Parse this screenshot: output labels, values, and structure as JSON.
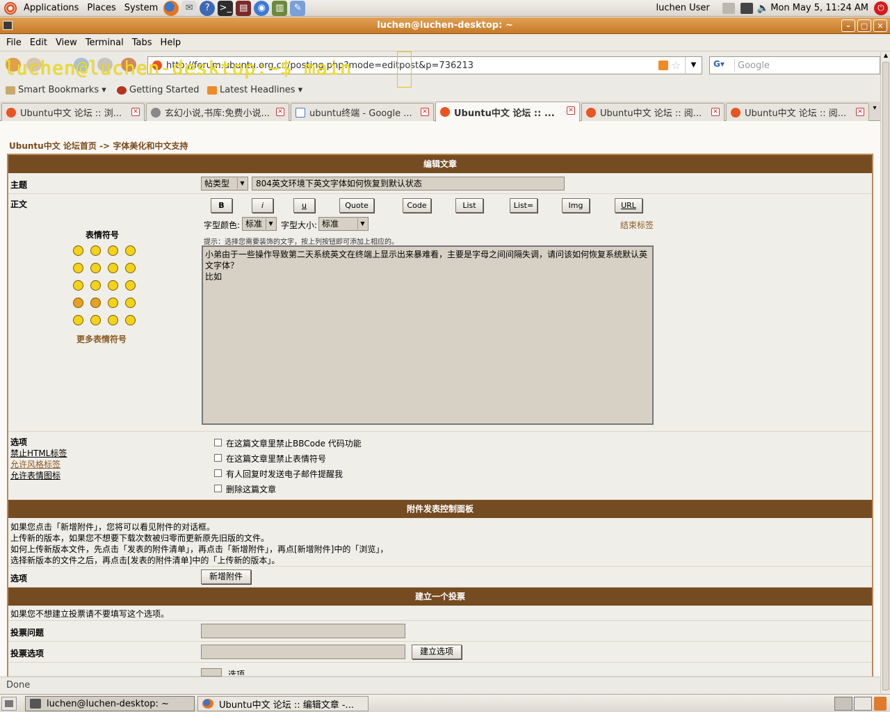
{
  "top_panel": {
    "menus": [
      "Applications",
      "Places",
      "System"
    ],
    "user": "luchen User",
    "clock": "Mon May  5, 11:24 AM"
  },
  "window": {
    "title": "luchen@luchen-desktop: ~"
  },
  "terminal_menu": [
    "File",
    "Edit",
    "View",
    "Terminal",
    "Tabs",
    "Help"
  ],
  "terminal": {
    "prompt": "luchen@luchen-desktop:~$ main"
  },
  "browser": {
    "url": "http://forum.ubuntu.org.cn/posting.php?mode=editpost&p=736213",
    "search_placeholder": "Google",
    "bookmarks": [
      "Smart Bookmarks",
      "Getting Started",
      "Latest Headlines"
    ],
    "tabs": [
      "Ubuntu中文 论坛 :: 浏...",
      "玄幻小说,书库:免费小说...",
      "ubuntu终端 - Google ...",
      "Ubuntu中文 论坛 :: ...",
      "Ubuntu中文 论坛 :: 阅...",
      "Ubuntu中文 论坛 :: 阅..."
    ],
    "status": "Done"
  },
  "page": {
    "breadcrumb_home": "Ubuntu中文 论坛首页",
    "breadcrumb_sep": "->",
    "breadcrumb_forum": "字体美化和中文支持",
    "edit_header": "编辑文章",
    "subject_label": "主题",
    "post_type": "帖类型",
    "subject_value": "804英文环境下英文字体如何恢复到默认状态",
    "body_label": "正文",
    "smilies_title": "表情符号",
    "more_smilies": "更多表情符号",
    "format_buttons": [
      "B",
      "i",
      "u",
      "Quote",
      "Code",
      "List",
      "List=",
      "Img",
      "URL"
    ],
    "font_color_label": "字型颜色:",
    "font_color_value": "标准",
    "font_size_label": "字型大小:",
    "font_size_value": "标准",
    "close_tags": "结束标签",
    "hint": "提示：选择您需要装饰的文字，按上列按钮即可添加上相应的。",
    "body_text": "小弟由于一些操作导致第二天系统英文在终端上显示出来暴难看，主要是字母之间间隔失调，请问该如何恢复系统默认英文字体？\n比如",
    "options_label": "选项",
    "options_notes": [
      "禁止HTML标签",
      "允许风格标签",
      "允许表情图标"
    ],
    "options": [
      "在这篇文章里禁止BBCode 代码功能",
      "在这篇文章里禁止表情符号",
      "有人回复时发送电子邮件提醒我",
      "删除这篇文章"
    ],
    "attach_header": "附件发表控制面板",
    "attach_lines": [
      "如果您点击「新增附件」，您将可以看见附件的对话框。",
      "上传新的版本，如果您不想要下载次数被归零而更新原先旧版的文件。",
      "如何上传新版本文件，先点击「发表的附件清单」，再点击「新增附件」，再点[新增附件]中的「浏览」，",
      "选择新版本的文件之后，再点击[发表的附件清单]中的「上传新的版本」。"
    ],
    "attach_options_label": "选项",
    "add_attachment": "新增附件",
    "poll_header": "建立一个投票",
    "poll_note": "如果您不想建立投票请不要填写这个选项。",
    "poll_question_label": "投票问题",
    "poll_option_label": "投票选项",
    "add_option": "建立选项",
    "partial_row": "选项"
  },
  "taskbar": {
    "tasks": [
      "luchen@luchen-desktop: ~",
      "Ubuntu中文 论坛 :: 编辑文章 -..."
    ]
  }
}
